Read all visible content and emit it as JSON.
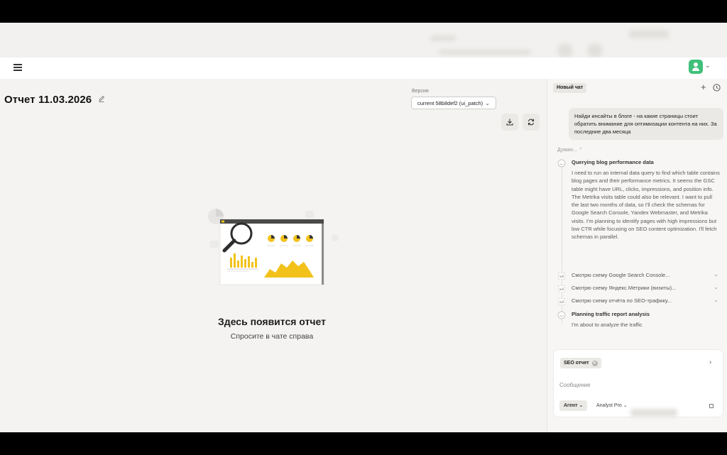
{
  "header": {
    "menu_icon": "hamburger-icon",
    "avatar_icon": "user-icon"
  },
  "report": {
    "title": "Отчет 11.03.2026",
    "version_label": "Версия",
    "version_value": "current 58b8def2 (ui_patch)",
    "empty_title": "Здесь появится отчет",
    "empty_subtitle": "Спросите в чате справа"
  },
  "chat": {
    "new_chat_label": "Новый чат",
    "user_message": "Найди инсайты в блоге - на какие страницы стоит обратить внимание для оптимизации контента на них. За последние два месяца",
    "thinking_label": "Думаю... ⌃",
    "steps": [
      {
        "title": "Querying blog performance data",
        "text": "I need to run an internal data query to find which table contains blog pages and their performance metrics. It seems the GSC table might have URL, clicks, impressions, and position info. The Metrika visits table could also be relevant. I want to pull the last two months of data, so I'll check the schemas for Google Search Console, Yandex Webmaster, and Metrika visits. I'm planning to identify pages with high impressions but low CTR while focusing on SEO content optimization. I'll fetch schemas in parallel."
      },
      {
        "title": "Planning traffic report analysis",
        "text": "I'm about to analyze the traffic"
      }
    ],
    "tools": [
      "Смотрю схему Google Search Console...",
      "Смотрю схему Яндекс.Метрики (визиты)...",
      "Смотрю схему отчёта по SEO-трафику..."
    ],
    "composer": {
      "tag": "SEO отчет",
      "placeholder": "Сообщение",
      "mode": "Агент",
      "model": "Analyst Pro"
    }
  },
  "colors": {
    "accent_yellow": "#f2c21b",
    "avatar_green": "#3fc07a",
    "background": "#f4f3f1"
  }
}
